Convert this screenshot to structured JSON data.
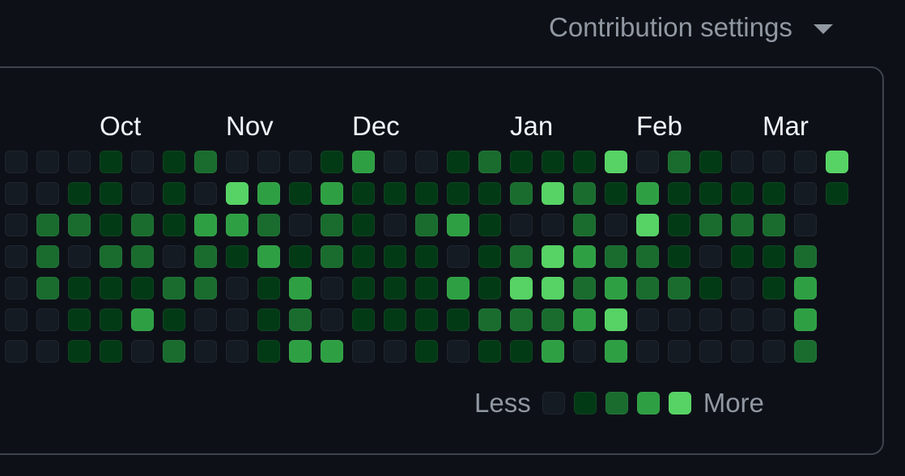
{
  "header": {
    "settings_label": "Contribution settings",
    "settings_icon": "triangle-down-icon"
  },
  "calendar": {
    "months": [
      {
        "label": "Oct",
        "week": 3
      },
      {
        "label": "Nov",
        "week": 7
      },
      {
        "label": "Dec",
        "week": 11
      },
      {
        "label": "Jan",
        "week": 16
      },
      {
        "label": "Feb",
        "week": 20
      },
      {
        "label": "Mar",
        "week": 24
      }
    ],
    "level_colors": [
      "#151b23",
      "#033a16",
      "#196c2e",
      "#2ea043",
      "#56d364"
    ],
    "weeks": [
      [
        0,
        0,
        0,
        0,
        0,
        0,
        0
      ],
      [
        0,
        0,
        2,
        2,
        2,
        0,
        0
      ],
      [
        0,
        1,
        2,
        0,
        1,
        1,
        1
      ],
      [
        1,
        1,
        1,
        2,
        1,
        1,
        1
      ],
      [
        0,
        0,
        2,
        2,
        1,
        3,
        0
      ],
      [
        1,
        1,
        1,
        0,
        2,
        1,
        2
      ],
      [
        2,
        0,
        3,
        2,
        2,
        0,
        0
      ],
      [
        0,
        4,
        3,
        1,
        0,
        0,
        0
      ],
      [
        0,
        3,
        2,
        3,
        1,
        1,
        1
      ],
      [
        0,
        1,
        0,
        1,
        3,
        2,
        3
      ],
      [
        1,
        3,
        2,
        2,
        0,
        0,
        3
      ],
      [
        3,
        1,
        1,
        1,
        1,
        1,
        0
      ],
      [
        0,
        1,
        0,
        1,
        1,
        1,
        0
      ],
      [
        0,
        1,
        2,
        1,
        1,
        1,
        1
      ],
      [
        1,
        1,
        3,
        0,
        3,
        1,
        0
      ],
      [
        2,
        1,
        1,
        1,
        1,
        2,
        1
      ],
      [
        1,
        2,
        0,
        2,
        4,
        2,
        1
      ],
      [
        1,
        4,
        0,
        4,
        4,
        2,
        3
      ],
      [
        1,
        2,
        2,
        3,
        2,
        3,
        0
      ],
      [
        4,
        1,
        0,
        2,
        3,
        4,
        3
      ],
      [
        0,
        3,
        4,
        2,
        2,
        0,
        0
      ],
      [
        2,
        1,
        1,
        1,
        2,
        0,
        0
      ],
      [
        1,
        1,
        2,
        0,
        1,
        0,
        0
      ],
      [
        0,
        1,
        2,
        1,
        0,
        0,
        0
      ],
      [
        0,
        1,
        2,
        1,
        1,
        0,
        0
      ],
      [
        0,
        0,
        0,
        2,
        3,
        3,
        2
      ],
      [
        4,
        1
      ]
    ]
  },
  "legend": {
    "less_label": "Less",
    "more_label": "More",
    "levels": [
      0,
      1,
      2,
      3,
      4
    ]
  }
}
